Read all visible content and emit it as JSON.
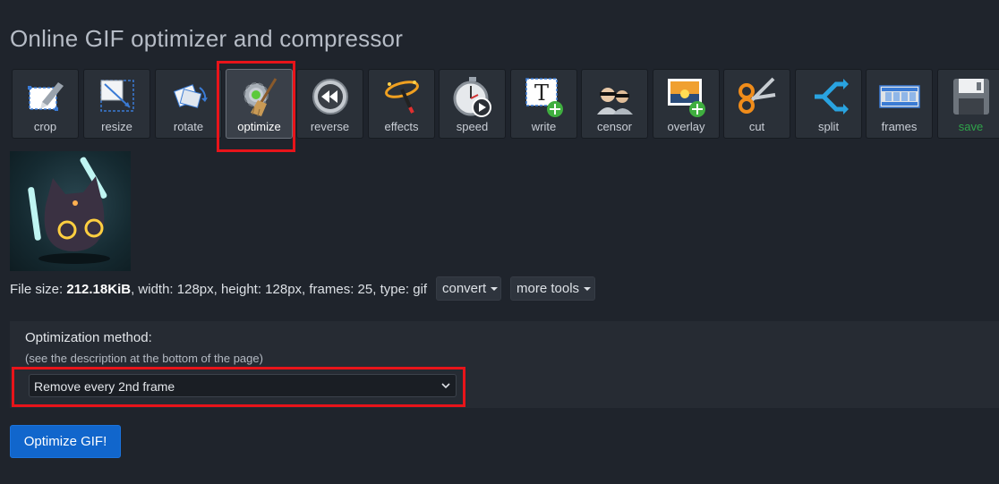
{
  "page": {
    "title": "Online GIF optimizer and compressor"
  },
  "toolbar": {
    "tools": [
      {
        "label": "crop",
        "icon": "crop-icon"
      },
      {
        "label": "resize",
        "icon": "resize-icon"
      },
      {
        "label": "rotate",
        "icon": "rotate-icon"
      },
      {
        "label": "optimize",
        "icon": "optimize-broom-gear-icon",
        "active": true
      },
      {
        "label": "reverse",
        "icon": "reverse-icon"
      },
      {
        "label": "effects",
        "icon": "effects-wand-icon"
      },
      {
        "label": "speed",
        "icon": "speed-stopwatch-icon"
      },
      {
        "label": "write",
        "icon": "write-text-icon"
      },
      {
        "label": "censor",
        "icon": "censor-people-icon"
      },
      {
        "label": "overlay",
        "icon": "overlay-image-icon"
      },
      {
        "label": "cut",
        "icon": "scissors-icon"
      },
      {
        "label": "split",
        "icon": "split-arrow-icon"
      },
      {
        "label": "frames",
        "icon": "film-frames-icon"
      },
      {
        "label": "save",
        "icon": "save-floppy-icon"
      }
    ]
  },
  "fileinfo": {
    "size_label": "File size: ",
    "size_value": "212.18KiB",
    "details": ", width: 128px, height: 128px, frames: 25, type: gif"
  },
  "buttons": {
    "convert": "convert",
    "more_tools": "more tools",
    "optimize": "Optimize GIF!"
  },
  "options": {
    "method_label": "Optimization method:",
    "method_hint": "(see the description at the bottom of the page)",
    "method_value": "Remove every 2nd frame"
  },
  "colors": {
    "accent_button": "#1166cc",
    "highlight": "#e8141a",
    "save_green": "#2fa34a",
    "background": "#1f242c"
  }
}
